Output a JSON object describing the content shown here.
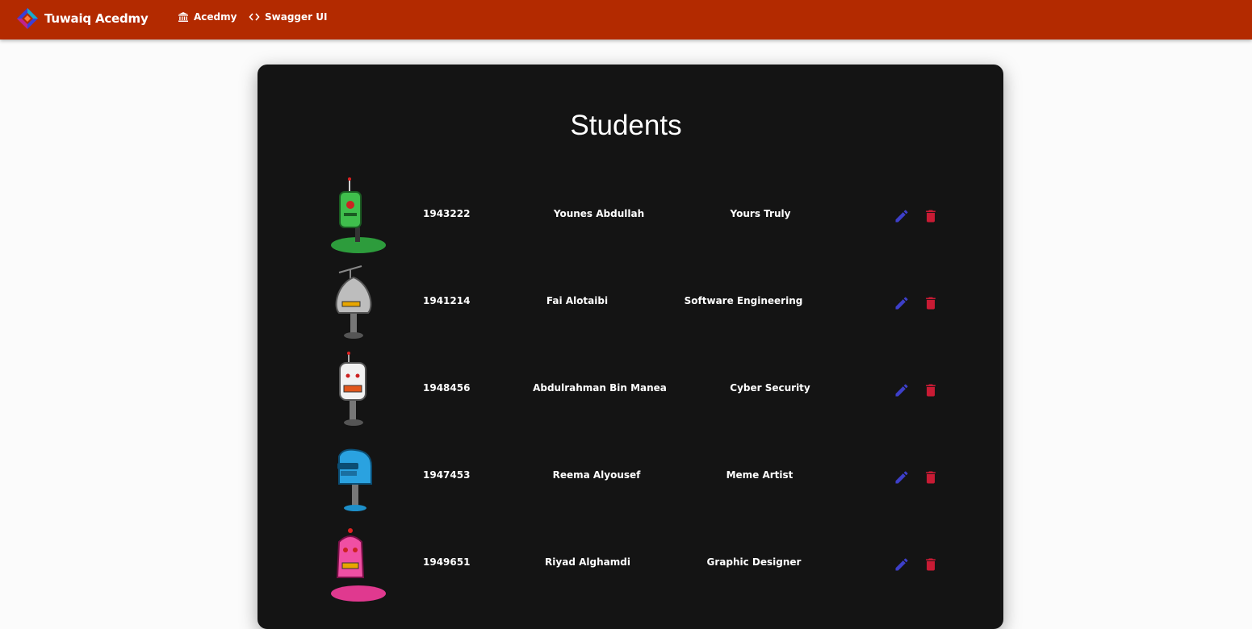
{
  "header": {
    "brand": "Tuwaiq Acedmy",
    "nav": [
      {
        "label": "Acedmy",
        "icon": "bank-icon"
      },
      {
        "label": "Swagger UI",
        "icon": "code-icon"
      }
    ]
  },
  "page": {
    "title": "Students"
  },
  "students": [
    {
      "id": "1943222",
      "name": "Younes Abdullah",
      "major": "Yours Truly",
      "avatar": "green-robot-icon"
    },
    {
      "id": "1941214",
      "name": "Fai Alotaibi",
      "major": "Software Engineering",
      "avatar": "grey-robot-icon"
    },
    {
      "id": "1948456",
      "name": "Abdulrahman Bin Manea",
      "major": "Cyber Security",
      "avatar": "white-robot-icon"
    },
    {
      "id": "1947453",
      "name": "Reema Alyousef",
      "major": "Meme Artist",
      "avatar": "blue-robot-icon"
    },
    {
      "id": "1949651",
      "name": "Riyad Alghamdi",
      "major": "Graphic Designer",
      "avatar": "pink-robot-icon"
    }
  ],
  "colors": {
    "header": "#b32a00",
    "card": "#141414",
    "edit": "#3d3fc9",
    "delete": "#c81b34"
  }
}
